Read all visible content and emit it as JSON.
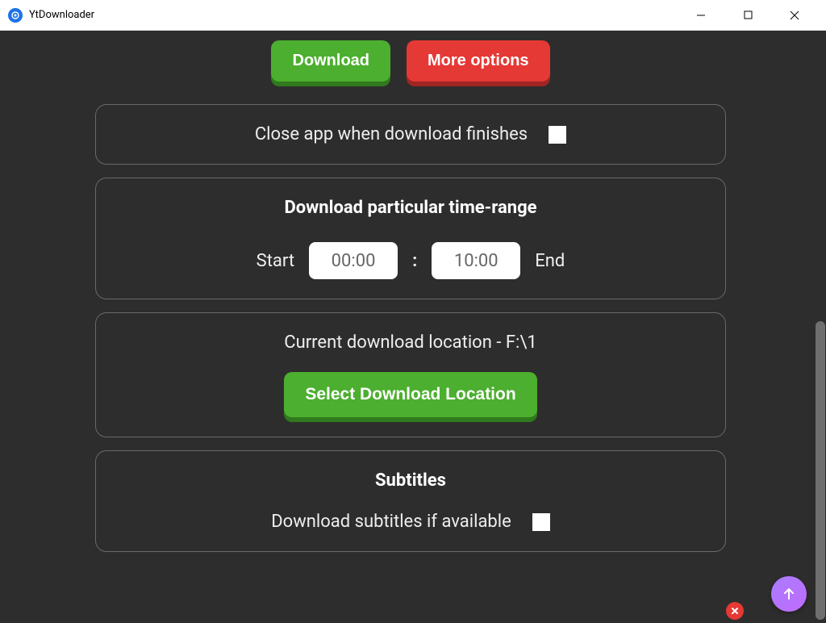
{
  "window": {
    "title": "YtDownloader"
  },
  "buttons": {
    "download": "Download",
    "more_options": "More options",
    "select_location": "Select Download Location"
  },
  "close_on_finish": {
    "label": "Close app when download finishes",
    "checked": false
  },
  "time_range": {
    "title": "Download particular time-range",
    "start_label": "Start",
    "end_label": "End",
    "start_value": "00:00",
    "end_value": "10:00",
    "separator": ":"
  },
  "download_location": {
    "prefix": "Current download location - ",
    "path": "F:\\1"
  },
  "subtitles": {
    "title": "Subtitles",
    "download_label": "Download subtitles if available",
    "checked": false
  },
  "colors": {
    "bg": "#2e2d2d",
    "green": "#4caf2f",
    "red": "#e53935",
    "accent": "#a97dff"
  }
}
